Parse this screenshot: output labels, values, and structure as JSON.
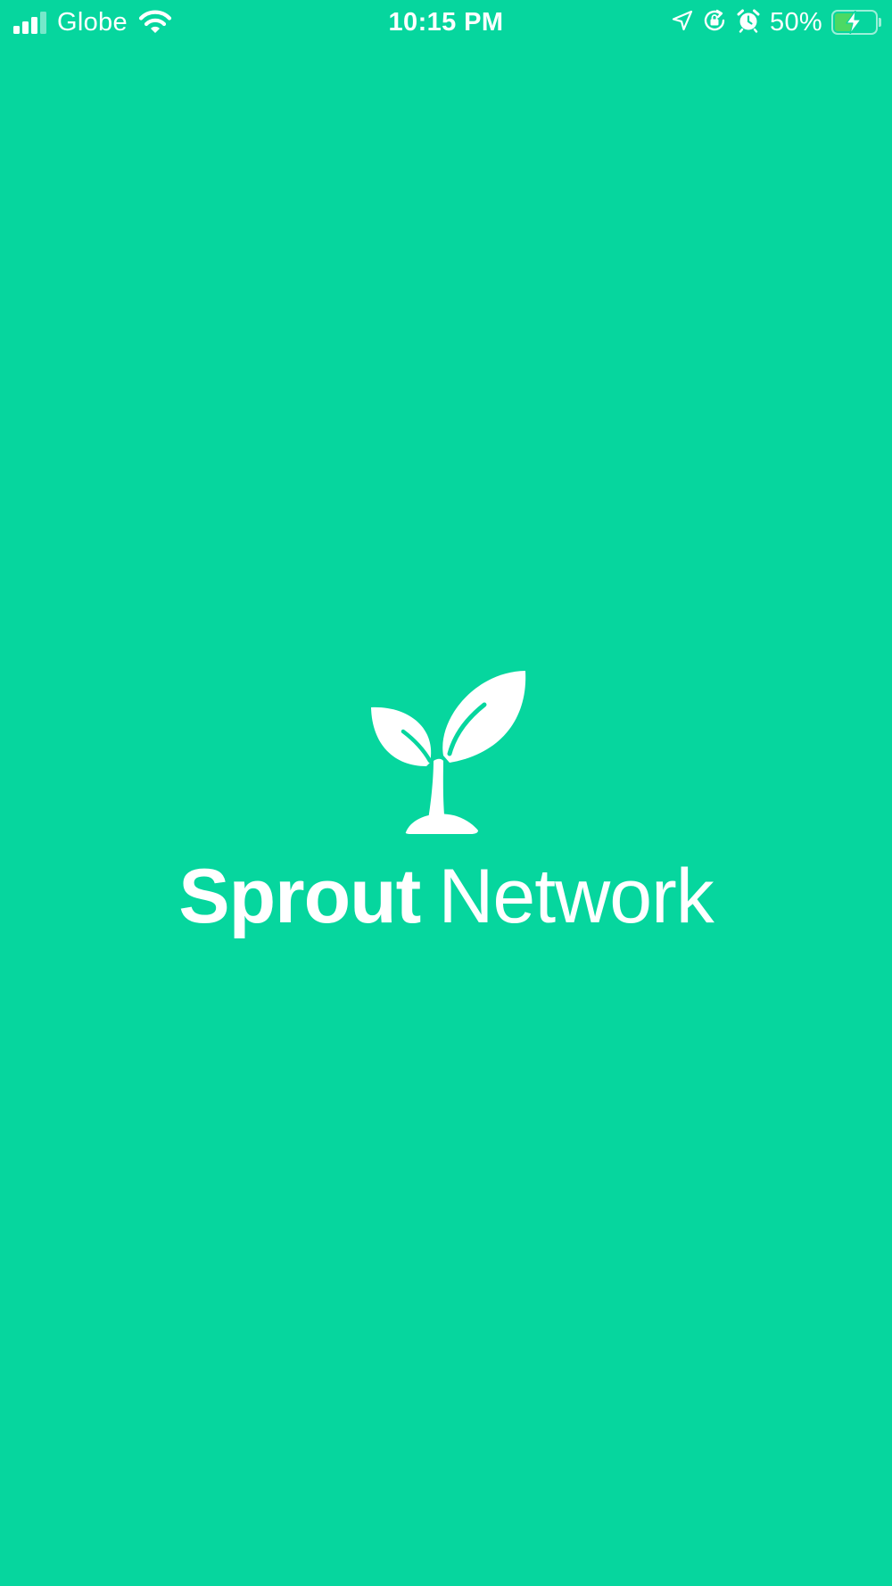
{
  "status_bar": {
    "carrier": "Globe",
    "time": "10:15 PM",
    "battery_percent": "50%",
    "battery_level": 0.5,
    "signal_bars_active": 3,
    "signal_bars_total": 4,
    "icons": [
      "signal-icon",
      "wifi-icon",
      "location-arrow-icon",
      "orientation-lock-icon",
      "alarm-icon",
      "battery-charging-icon"
    ]
  },
  "brand": {
    "name_bold": "Sprout",
    "name_light": "Network",
    "logo_icon": "sprout-icon"
  },
  "colors": {
    "background": "#06D69E",
    "foreground": "#FFFFFF",
    "battery_fill": "#4CD964"
  }
}
